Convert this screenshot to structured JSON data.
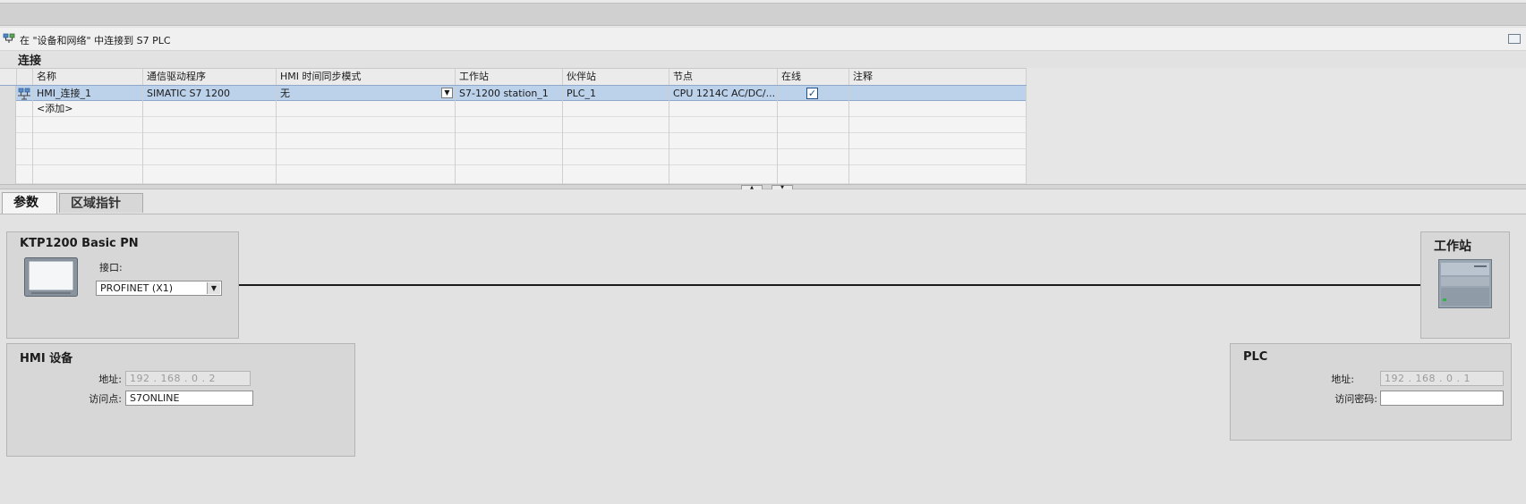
{
  "header": {
    "title": "在 \"设备和网络\" 中连接到 S7 PLC"
  },
  "section_title": "连接",
  "table": {
    "columns": [
      "名称",
      "通信驱动程序",
      "HMI 时间同步模式",
      "工作站",
      "伙伴站",
      "节点",
      "在线",
      "注释"
    ],
    "rows": [
      {
        "name": "HMI_连接_1",
        "driver": "SIMATIC S7 1200",
        "sync_mode": "无",
        "station": "S7-1200 station_1",
        "partner": "PLC_1",
        "node": "CPU 1214C AC/DC/...",
        "online": true,
        "comment": ""
      }
    ],
    "add_label": "<添加>"
  },
  "tabs": [
    {
      "label": "参数",
      "active": true
    },
    {
      "label": "区域指针",
      "active": false
    }
  ],
  "hmi_device": {
    "title": "KTP1200 Basic PN",
    "interface_label": "接口:",
    "interface_value": "PROFINET (X1)"
  },
  "station": {
    "title": "工作站"
  },
  "hmi_settings": {
    "title": "HMI 设备",
    "address_label": "地址:",
    "address_value": "192 . 168 . 0   . 2",
    "access_point_label": "访问点:",
    "access_point_value": "S7ONLINE"
  },
  "plc_settings": {
    "title": "PLC",
    "address_label": "地址:",
    "address_value": "192 . 168 . 0   . 1",
    "password_label": "访问密码:",
    "password_value": ""
  },
  "colors": {
    "selected_row": "#bcd1ea",
    "panel_bg": "#d7d7d7",
    "page_bg": "#e2e2e2"
  }
}
